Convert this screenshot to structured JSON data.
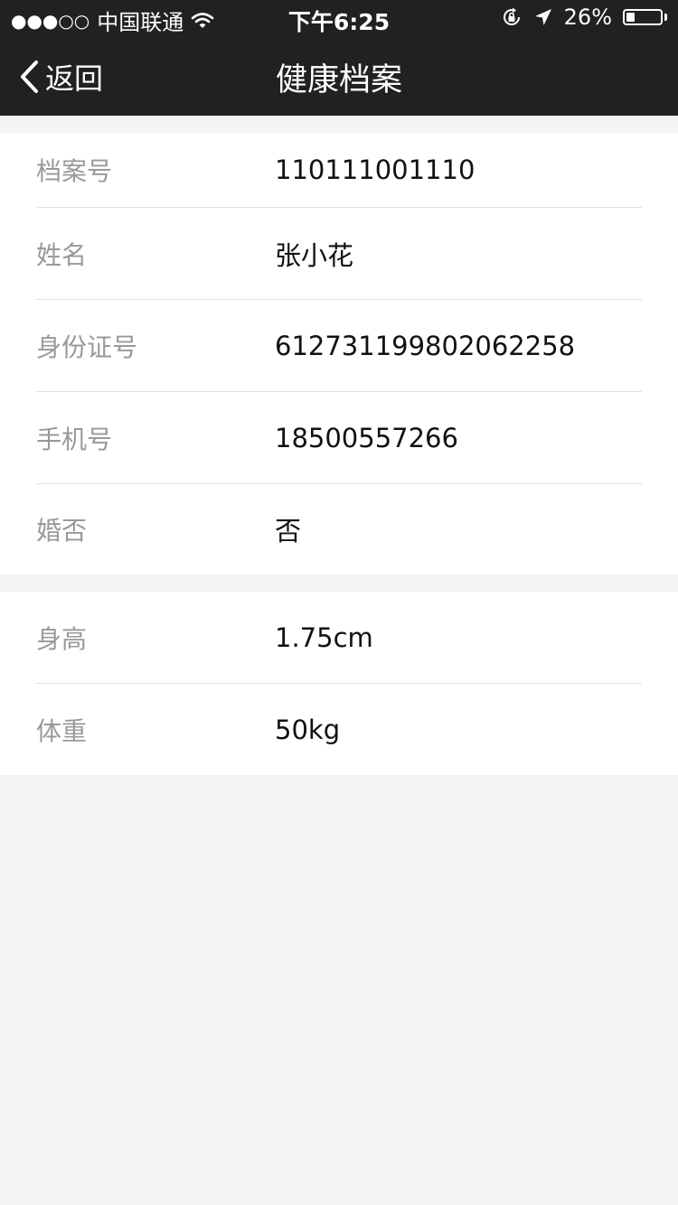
{
  "status_bar": {
    "signal": "●●●○○",
    "carrier": "中国联通",
    "time": "下午6:25",
    "battery_percent": "26%",
    "battery_level": 0.26
  },
  "nav": {
    "back_label": "返回",
    "title": "健康档案"
  },
  "profile": {
    "rows": [
      {
        "label": "档案号",
        "value": "110111001110"
      },
      {
        "label": "姓名",
        "value": "张小花"
      },
      {
        "label": "身份证号",
        "value": "612731199802062258"
      },
      {
        "label": "手机号",
        "value": "18500557266"
      },
      {
        "label": "婚否",
        "value": "否"
      }
    ]
  },
  "body": {
    "rows": [
      {
        "label": "身高",
        "value": "1.75cm"
      },
      {
        "label": "体重",
        "value": "50kg"
      }
    ]
  }
}
